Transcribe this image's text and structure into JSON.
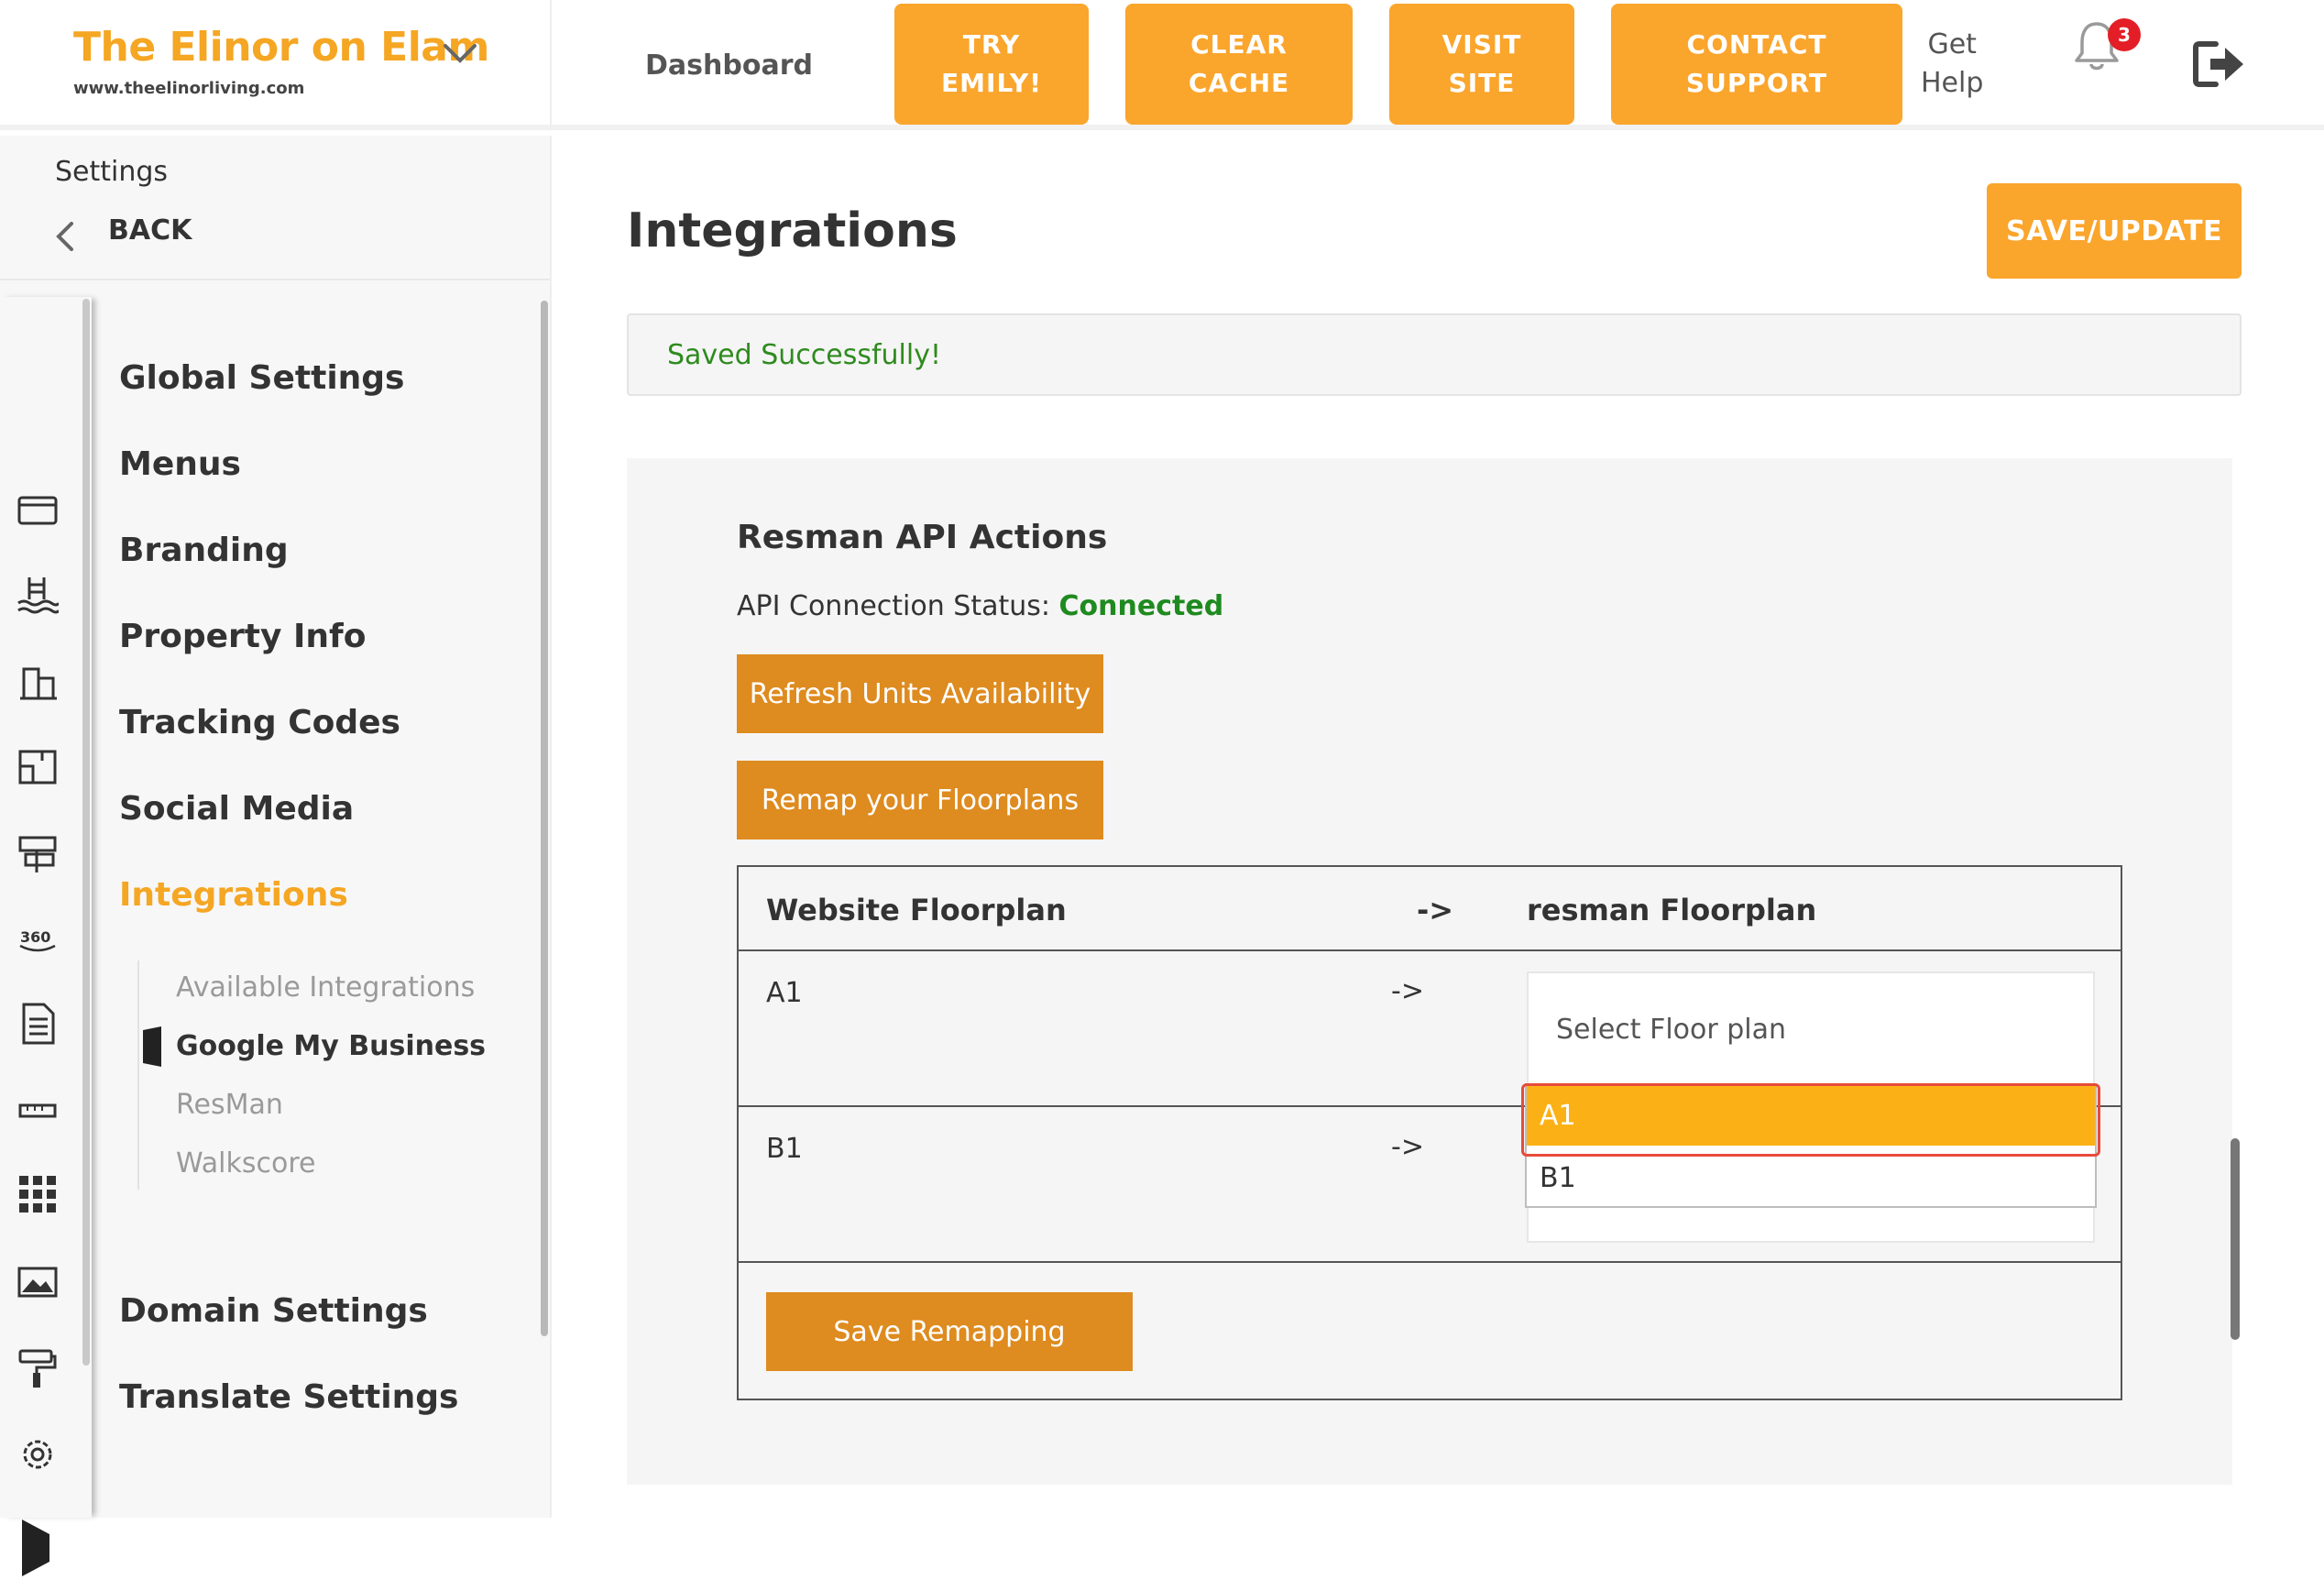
{
  "header": {
    "brand_name": "The Elinor on Elam",
    "brand_url": "www.theelinorliving.com",
    "dashboard": "Dashboard",
    "buttons": {
      "try_emily": "TRY\nEMILY!",
      "clear_cache": "CLEAR\nCACHE",
      "visit_site": "VISIT\nSITE",
      "contact_support": "CONTACT\nSUPPORT"
    },
    "get_help": "Get\nHelp",
    "notification_count": "3"
  },
  "sidebar": {
    "settings_label": "Settings",
    "back_label": "BACK",
    "rail_icons": [
      "window-icon",
      "pool-icon",
      "buildings-icon",
      "floorplan-icon",
      "sign-icon",
      "360-icon",
      "document-icon",
      "ruler-icon",
      "grid-icon",
      "image-icon",
      "paint-roller-icon",
      "gear-icon",
      "play-icon"
    ],
    "nav": {
      "global_settings": "Global Settings",
      "menus": "Menus",
      "branding": "Branding",
      "property_info": "Property Info",
      "tracking_codes": "Tracking Codes",
      "social_media": "Social Media",
      "integrations": "Integrations",
      "domain_settings": "Domain Settings",
      "translate_settings": "Translate Settings"
    },
    "sub_nav": {
      "available_integrations": "Available Integrations",
      "google_my_business": "Google My Business",
      "resman": "ResMan",
      "walkscore": "Walkscore"
    }
  },
  "main": {
    "title": "Integrations",
    "save_update": "SAVE/UPDATE",
    "alert": "Saved Successfully!",
    "section_title": "Resman API Actions",
    "status_label": "API Connection Status: ",
    "status_value": "Connected",
    "refresh_button": "Refresh Units Availability",
    "remap_button": "Remap your Floorplans",
    "table": {
      "col_website": "Website Floorplan",
      "col_arrow": "->",
      "col_resman": "resman Floorplan",
      "rows": [
        {
          "website": "A1",
          "arrow": "->"
        },
        {
          "website": "B1",
          "arrow": "->"
        }
      ],
      "select_placeholder": "Select Floor plan",
      "dropdown_options": [
        "A1",
        "B1"
      ],
      "save_remapping": "Save Remapping"
    }
  },
  "colors": {
    "accent": "#faa52c",
    "action": "#de8b1f",
    "success": "#2e8b1e",
    "selected_option": "#fbb116"
  }
}
